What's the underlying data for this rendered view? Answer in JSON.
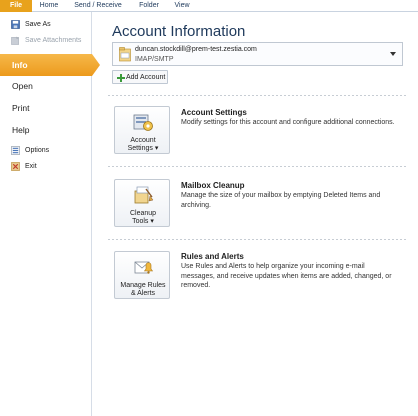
{
  "ribbon": {
    "tabs": [
      "File",
      "Home",
      "Send / Receive",
      "Folder",
      "View"
    ]
  },
  "nav": {
    "save_as": "Save As",
    "save_attachments": "Save Attachments",
    "info": "Info",
    "open": "Open",
    "print": "Print",
    "help": "Help",
    "options": "Options",
    "exit": "Exit"
  },
  "main": {
    "title": "Account Information",
    "account": {
      "email": "duncan.stockdill@prem-test.zestia.com",
      "type": "IMAP/SMTP"
    },
    "add_account": "Add Account",
    "sections": [
      {
        "button_line1": "Account",
        "button_line2": "Settings ▾",
        "title": "Account Settings",
        "description": "Modify settings for this account and configure additional connections."
      },
      {
        "button_line1": "Cleanup",
        "button_line2": "Tools ▾",
        "title": "Mailbox Cleanup",
        "description": "Manage the size of your mailbox by emptying Deleted Items and archiving."
      },
      {
        "button_line1": "Manage Rules",
        "button_line2": "& Alerts",
        "title": "Rules and Alerts",
        "description": "Use Rules and Alerts to help organize your incoming e-mail messages, and receive updates when items are added, changed, or removed."
      }
    ]
  },
  "colors": {
    "file_tab": "#e8a21c",
    "selected_nav": "#f0a42a",
    "title_text": "#1e395b"
  },
  "icons": [
    "save-as-icon",
    "save-attachments-icon",
    "options-icon",
    "exit-icon",
    "mail-folder-icon",
    "dropdown-caret-icon",
    "add-icon",
    "account-settings-icon",
    "cleanup-tools-icon",
    "rules-alerts-icon"
  ]
}
